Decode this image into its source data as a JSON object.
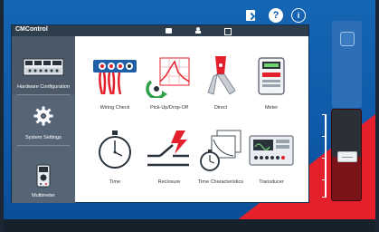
{
  "app": {
    "title": "CMControl"
  },
  "sidebar": {
    "items": [
      {
        "label": "Hardware Configuration"
      },
      {
        "label": "System Settings"
      },
      {
        "label": "Multimeter"
      }
    ]
  },
  "tiles": [
    {
      "label": "Wiring Check"
    },
    {
      "label": "Pick-Up/Drop-Off"
    },
    {
      "label": "Direct"
    },
    {
      "label": "Meter"
    },
    {
      "label": "Time"
    },
    {
      "label": "Reclosure"
    },
    {
      "label": "Time Characteristics"
    },
    {
      "label": "Transducer"
    }
  ],
  "icons": {
    "export": "export-icon",
    "help": "help-icon",
    "info": "info-icon",
    "help_glyph": "?",
    "info_glyph": "i"
  },
  "colors": {
    "background": "#0e58a8",
    "titlebar": "#2f3e4c",
    "sidebar": "#566575",
    "accent_red": "#e3202b"
  }
}
